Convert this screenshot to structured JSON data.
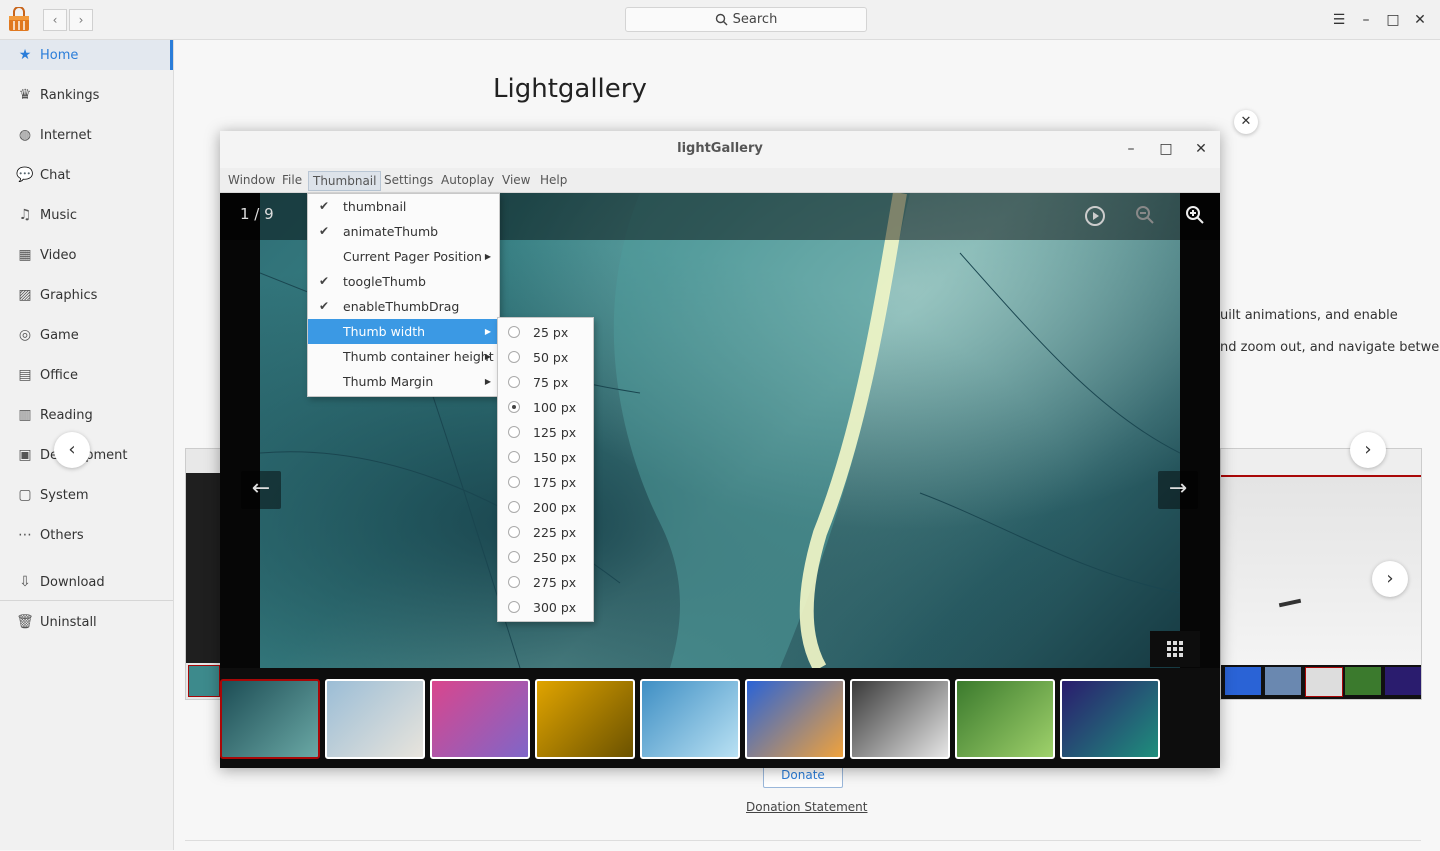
{
  "topbar": {
    "search_placeholder": "Search",
    "back_glyph": "‹",
    "forward_glyph": "›"
  },
  "sidebar": {
    "items": [
      {
        "label": "Home",
        "icon": "star-icon",
        "glyph": "★"
      },
      {
        "label": "Rankings",
        "icon": "crown-icon",
        "glyph": "♛"
      },
      {
        "label": "Internet",
        "icon": "globe-icon",
        "glyph": "◍"
      },
      {
        "label": "Chat",
        "icon": "chat-bubble-icon",
        "glyph": "💬"
      },
      {
        "label": "Music",
        "icon": "music-note-icon",
        "glyph": "♫"
      },
      {
        "label": "Video",
        "icon": "film-icon",
        "glyph": "▦"
      },
      {
        "label": "Graphics",
        "icon": "image-icon",
        "glyph": "▨"
      },
      {
        "label": "Game",
        "icon": "gamepad-icon",
        "glyph": "◎"
      },
      {
        "label": "Office",
        "icon": "office-icon",
        "glyph": "▤"
      },
      {
        "label": "Reading",
        "icon": "book-icon",
        "glyph": "▥"
      },
      {
        "label": "Development",
        "icon": "terminal-icon",
        "glyph": "▣"
      },
      {
        "label": "System",
        "icon": "system-icon",
        "glyph": "▢"
      },
      {
        "label": "Others",
        "icon": "more-icon",
        "glyph": "⋯"
      }
    ],
    "footer_items": [
      {
        "label": "Download",
        "icon": "download-icon",
        "glyph": "⇩"
      },
      {
        "label": "Uninstall",
        "icon": "trash-icon",
        "glyph": "🗑"
      }
    ]
  },
  "main": {
    "app_title": "Lightgallery",
    "desc_line1": "uilt animations, and enable",
    "desc_line2": "nd zoom out, and navigate between",
    "donate_label": "Donate",
    "donation_statement": "Donation Statement"
  },
  "lightgallery": {
    "window_title": "lightGallery",
    "menus": [
      "Window",
      "File",
      "Thumbnail",
      "Settings",
      "Autoplay",
      "View",
      "Help"
    ],
    "counter": "1 / 9",
    "thumbnail_menu": [
      {
        "label": "thumbnail",
        "checked": true,
        "submenu": false
      },
      {
        "label": "animateThumb",
        "checked": true,
        "submenu": false
      },
      {
        "label": "Current Pager Position",
        "checked": false,
        "submenu": true
      },
      {
        "label": "toogleThumb",
        "checked": true,
        "submenu": false
      },
      {
        "label": "enableThumbDrag",
        "checked": true,
        "submenu": false
      },
      {
        "label": "Thumb width",
        "checked": false,
        "submenu": true,
        "highlighted": true
      },
      {
        "label": "Thumb container height",
        "checked": false,
        "submenu": true
      },
      {
        "label": "Thumb Margin",
        "checked": false,
        "submenu": true
      }
    ],
    "thumb_width_options": [
      "25 px",
      "50 px",
      "75 px",
      "100 px",
      "125 px",
      "150 px",
      "175 px",
      "200 px",
      "225 px",
      "250 px",
      "275 px",
      "300 px"
    ],
    "thumb_width_selected": "100 px",
    "thumbnails": [
      {
        "colors": [
          "#1d4d55",
          "#6aa8a5"
        ]
      },
      {
        "colors": [
          "#9bbdd6",
          "#e8e4dc"
        ]
      },
      {
        "colors": [
          "#d9468d",
          "#7f66c8"
        ]
      },
      {
        "colors": [
          "#e0a400",
          "#6b5200"
        ]
      },
      {
        "colors": [
          "#3f8fc4",
          "#b9e1f3"
        ]
      },
      {
        "colors": [
          "#2a63d6",
          "#f0a23c"
        ]
      },
      {
        "colors": [
          "#3a3a3a",
          "#e6e6e6"
        ]
      },
      {
        "colors": [
          "#3b7a2d",
          "#9fd16b"
        ]
      },
      {
        "colors": [
          "#2a1c6e",
          "#1f8f7c"
        ]
      }
    ]
  },
  "colors": {
    "accent": "#2a7dd9",
    "menu_highlight": "#3b99e4",
    "active_thumb_border": "#a90707"
  }
}
